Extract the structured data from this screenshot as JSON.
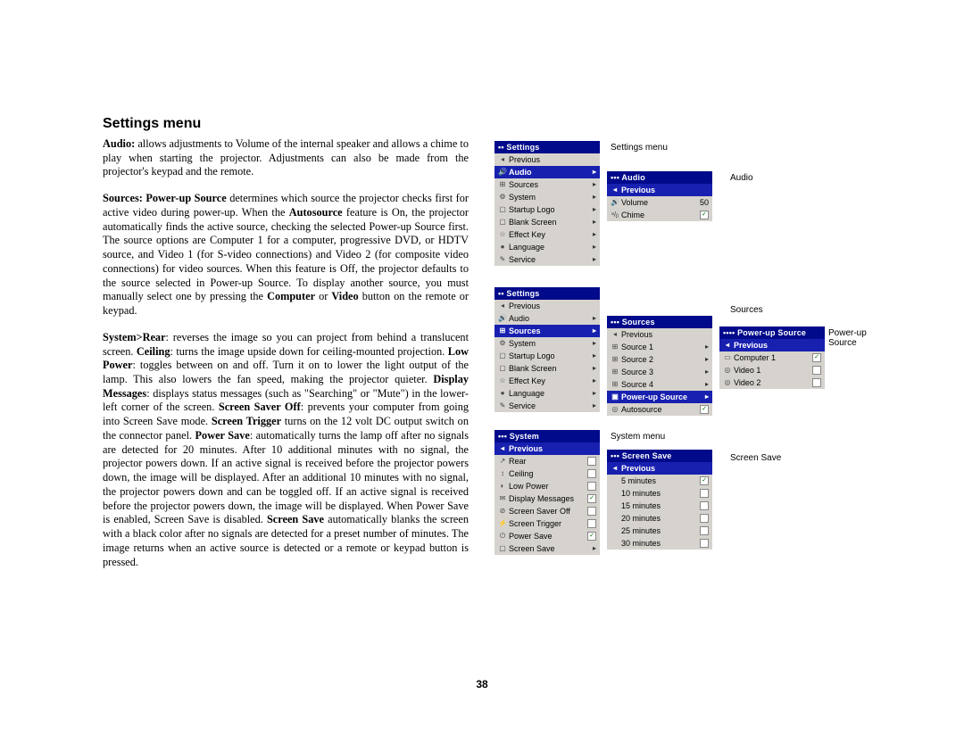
{
  "heading": "Settings menu",
  "para1_html": "<b>Audio:</b> allows adjustments to Volume of the internal speaker and allows a chime to play when starting the projector. Adjustments can also be made from the projector's keypad and the remote.",
  "para2_html": "<b>Sources: Power-up Source</b> determines which source the projector checks first for active video during power-up. When the <b>Autosource</b> feature is On, the projector automatically finds the active source, checking the selected Power-up Source first. The source options are Computer 1 for a computer, progressive DVD, or HDTV source, and Video 1 (for S-video connections) and Video 2 (for composite video connections) for video sources. When this feature is Off, the projector defaults to the source selected in Power-up Source. To display another source, you must manually select one by pressing the <b>Computer</b> or <b>Video</b> button on the remote or keypad.",
  "para3_html": "<b>System&gt;Rear</b>: reverses the image so you can project from behind a translucent screen. <b>Ceiling</b>: turns the image upside down for ceiling-mounted projection. <b>Low Power</b>: toggles between on and off. Turn it on to lower the light output of the lamp. This also lowers the fan speed, making the projector quieter. <b>Display Messages</b>: displays status messages (such as \"Searching\" or \"Mute\") in the lower-left corner of the screen. <b>Screen Saver Off</b>: prevents your computer from going into Screen Save mode. <b>Screen Trigger</b> turns on the 12 volt DC output switch on the connector panel. <b>Power Save</b>: automatically turns the lamp off after no signals are detected for 20 minutes. After 10 additional minutes with no signal, the projector powers down. If an active signal is received before the projector powers down, the image will be displayed. After an additional 10 minutes with no signal, the projector powers down and can be toggled off. If an active signal is received before the projector powers down, the image will be displayed. When Power Save is enabled, Screen Save is disabled. <b>Screen Save</b> automatically blanks the screen with a black color after no signals are detected for a preset number of minutes. The image returns when an active source is detected or a remote or keypad button is pressed.",
  "page_number": "38",
  "captions": {
    "settings": "Settings menu",
    "audio": "Audio",
    "sources": "Sources",
    "powerup": "Power-up Source",
    "system": "System menu",
    "screensave": "Screen Save"
  },
  "menus": {
    "settings1": {
      "title": "••  Settings",
      "items": [
        {
          "ico": "◂",
          "label": "Previous",
          "arr": ""
        },
        {
          "ico": "🔊",
          "label": "Audio",
          "arr": "▸",
          "selected": true
        },
        {
          "ico": "⊞",
          "label": "Sources",
          "arr": "▸"
        },
        {
          "ico": "⚙",
          "label": "System",
          "arr": "▸"
        },
        {
          "ico": "▢",
          "label": "Startup Logo",
          "arr": "▸"
        },
        {
          "ico": "▢",
          "label": "Blank Screen",
          "arr": "▸"
        },
        {
          "ico": "☆",
          "label": "Effect Key",
          "arr": "▸"
        },
        {
          "ico": "●",
          "label": "Language",
          "arr": "▸"
        },
        {
          "ico": "✎",
          "label": "Service",
          "arr": "▸"
        }
      ]
    },
    "audio": {
      "title": "•••  Audio",
      "items": [
        {
          "ico": "◂",
          "label": "Previous",
          "arr": "",
          "selected": true
        },
        {
          "ico": "🔊",
          "label": "Volume",
          "val": "50"
        },
        {
          "ico": "ᵃ/ᵦ",
          "label": "Chime",
          "chk": true
        }
      ]
    },
    "settings2": {
      "title": "••  Settings",
      "items": [
        {
          "ico": "◂",
          "label": "Previous",
          "arr": ""
        },
        {
          "ico": "🔊",
          "label": "Audio",
          "arr": "▸"
        },
        {
          "ico": "⊞",
          "label": "Sources",
          "arr": "▸",
          "selected": true
        },
        {
          "ico": "⚙",
          "label": "System",
          "arr": "▸"
        },
        {
          "ico": "▢",
          "label": "Startup Logo",
          "arr": "▸"
        },
        {
          "ico": "▢",
          "label": "Blank Screen",
          "arr": "▸"
        },
        {
          "ico": "☆",
          "label": "Effect Key",
          "arr": "▸"
        },
        {
          "ico": "●",
          "label": "Language",
          "arr": "▸"
        },
        {
          "ico": "✎",
          "label": "Service",
          "arr": "▸"
        }
      ]
    },
    "sources": {
      "title": "•••  Sources",
      "items": [
        {
          "ico": "◂",
          "label": "Previous",
          "arr": ""
        },
        {
          "ico": "⊞",
          "label": "Source 1",
          "arr": "▸"
        },
        {
          "ico": "⊞",
          "label": "Source 2",
          "arr": "▸"
        },
        {
          "ico": "⊞",
          "label": "Source 3",
          "arr": "▸"
        },
        {
          "ico": "⊞",
          "label": "Source 4",
          "arr": "▸"
        },
        {
          "ico": "▣",
          "label": "Power-up Source",
          "arr": "▸",
          "selected": true
        },
        {
          "ico": "◎",
          "label": "Autosource",
          "chk": true
        }
      ]
    },
    "powerup": {
      "title": "••••  Power-up Source",
      "items": [
        {
          "ico": "◂",
          "label": "Previous",
          "arr": "",
          "selected": true
        },
        {
          "ico": "▭",
          "label": "Computer 1",
          "chk": true
        },
        {
          "ico": "◎",
          "label": "Video 1",
          "chk": false
        },
        {
          "ico": "◎",
          "label": "Video 2",
          "chk": false
        }
      ]
    },
    "system": {
      "title": "•••  System",
      "items": [
        {
          "ico": "◂",
          "label": "Previous",
          "arr": "",
          "selected": true
        },
        {
          "ico": "↗",
          "label": "Rear",
          "chk": false
        },
        {
          "ico": "↕",
          "label": "Ceiling",
          "chk": false
        },
        {
          "ico": "◐",
          "label": "Low Power",
          "chk": false
        },
        {
          "ico": "✉",
          "label": "Display Messages",
          "chk": true
        },
        {
          "ico": "⊘",
          "label": "Screen Saver Off",
          "chk": false
        },
        {
          "ico": "⚡",
          "label": "Screen Trigger",
          "chk": false
        },
        {
          "ico": "⏻",
          "label": "Power Save",
          "chk": true
        },
        {
          "ico": "▢",
          "label": "Screen Save",
          "arr": "▸"
        }
      ]
    },
    "screensave": {
      "title": "•••  Screen Save",
      "items": [
        {
          "ico": "◂",
          "label": "Previous",
          "arr": "",
          "selected": true
        },
        {
          "ico": "",
          "label": "5 minutes",
          "chk": true
        },
        {
          "ico": "",
          "label": "10 minutes",
          "chk": false
        },
        {
          "ico": "",
          "label": "15 minutes",
          "chk": false
        },
        {
          "ico": "",
          "label": "20 minutes",
          "chk": false
        },
        {
          "ico": "",
          "label": "25 minutes",
          "chk": false
        },
        {
          "ico": "",
          "label": "30 minutes",
          "chk": false
        }
      ]
    }
  }
}
